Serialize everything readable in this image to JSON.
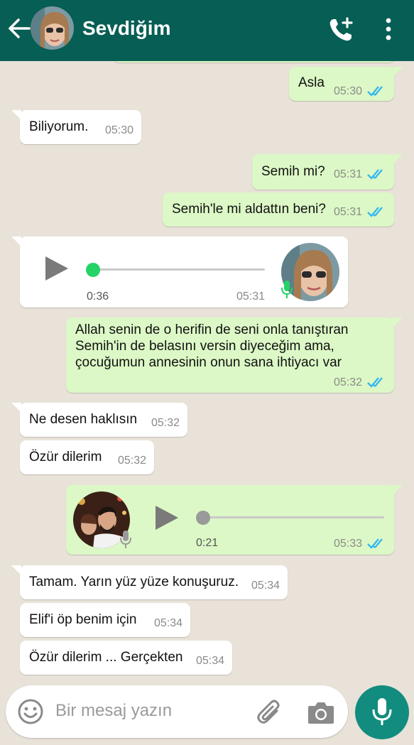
{
  "header": {
    "contact_name": "Sevdiğim"
  },
  "messages": [
    {
      "dir": "out",
      "text": "Asla",
      "time": "05:30",
      "read": true
    },
    {
      "dir": "in",
      "text": "Biliyorum.",
      "time": "05:30"
    },
    {
      "dir": "out",
      "text": "Semih mi?",
      "time": "05:31",
      "read": true
    },
    {
      "dir": "out",
      "text": "Semih'le mi aldattın beni?",
      "time": "05:31",
      "read": true
    },
    {
      "dir": "in",
      "type": "voice",
      "duration": "0:36",
      "time": "05:31"
    },
    {
      "dir": "out",
      "text": "Allah senin de o herifin de seni onla tanıştıran Semih'in de belasını versin diyeceğim ama, çocuğumun annesinin onun sana ihtiyacı var",
      "time": "05:32",
      "read": true
    },
    {
      "dir": "in",
      "text": "Ne desen haklısın",
      "time": "05:32"
    },
    {
      "dir": "in",
      "text": "Özür dilerim",
      "time": "05:32"
    },
    {
      "dir": "out",
      "type": "voice",
      "duration": "0:21",
      "time": "05:33",
      "read": true
    },
    {
      "dir": "in",
      "text": "Tamam. Yarın yüz yüze konuşuruz.",
      "time": "05:34"
    },
    {
      "dir": "in",
      "text": "Elif'i öp benim için",
      "time": "05:34"
    },
    {
      "dir": "in",
      "text": "Özür dilerim ... Gerçekten",
      "time": "05:34"
    }
  ],
  "composer": {
    "placeholder": "Bir mesaj yazın"
  },
  "colors": {
    "header": "#075e54",
    "outgoing_bubble": "#dcf8c6",
    "incoming_bubble": "#ffffff",
    "read_ticks": "#34b7f1",
    "voice_knob_incoming": "#25d366",
    "mic_button": "#128c7e"
  },
  "icons": [
    "back-arrow-icon",
    "add-call-icon",
    "more-vert-icon",
    "play-icon",
    "mic-icon",
    "emoji-icon",
    "attach-icon",
    "camera-icon",
    "read-ticks-icon"
  ]
}
